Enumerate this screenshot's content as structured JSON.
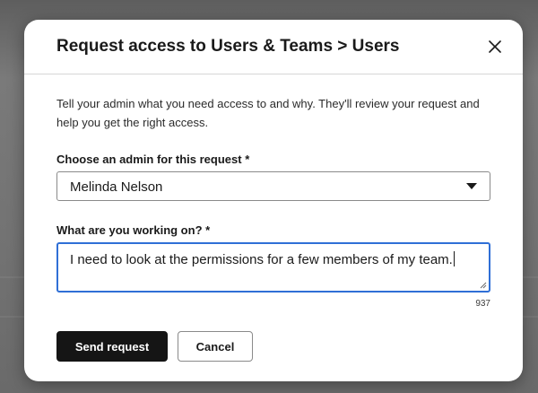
{
  "dialog": {
    "title": "Request access to Users & Teams > Users",
    "description": "Tell your admin what you need access to and why. They'll review your request and help you get the right access.",
    "close_icon": "close-icon"
  },
  "admin_field": {
    "label": "Choose an admin for this request *",
    "selected_value": "Melinda Nelson",
    "caret_icon": "caret-down-icon"
  },
  "working_field": {
    "label": "What are you working on? *",
    "value": "I need to look at the permissions for a few members of my team.",
    "char_count": "937"
  },
  "actions": {
    "send_label": "Send request",
    "cancel_label": "Cancel"
  },
  "colors": {
    "focus_border": "#2f6fd6",
    "primary_button": "#151515"
  }
}
